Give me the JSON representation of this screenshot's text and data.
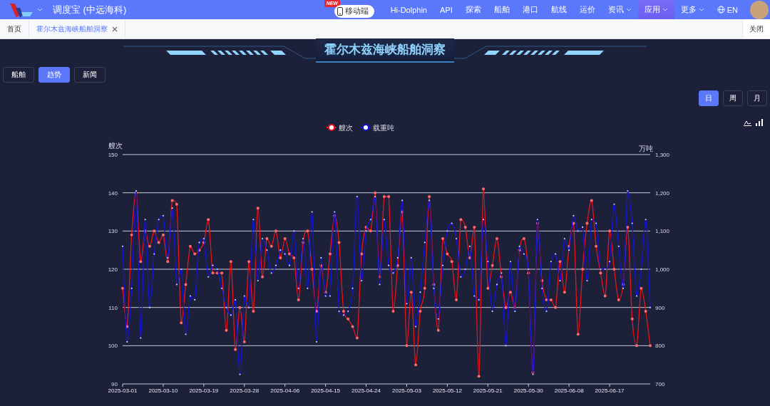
{
  "nav": {
    "title": "调度宝 (中远海科)",
    "mobile": {
      "label": "移动端",
      "badge": "NEW"
    },
    "items": [
      {
        "label": "Hi-Dolphin",
        "dropdown": false,
        "selected": false
      },
      {
        "label": "API",
        "dropdown": false,
        "selected": false
      },
      {
        "label": "探索",
        "dropdown": false,
        "selected": false
      },
      {
        "label": "船舶",
        "dropdown": false,
        "selected": false
      },
      {
        "label": "港口",
        "dropdown": false,
        "selected": false
      },
      {
        "label": "航线",
        "dropdown": false,
        "selected": false
      },
      {
        "label": "运价",
        "dropdown": false,
        "selected": false
      },
      {
        "label": "资讯",
        "dropdown": true,
        "selected": false
      },
      {
        "label": "应用",
        "dropdown": true,
        "selected": true
      },
      {
        "label": "更多",
        "dropdown": true,
        "selected": false
      }
    ],
    "language": "EN"
  },
  "tabs": {
    "items": [
      {
        "label": "首页",
        "selected": false,
        "closable": false
      },
      {
        "label": "霍尔木兹海峡船舶洞察",
        "selected": true,
        "closable": true
      }
    ],
    "close_all": "关闭"
  },
  "banner": {
    "title": "霍尔木兹海峡船舶洞察"
  },
  "views": [
    {
      "label": "船舶",
      "selected": false
    },
    {
      "label": "趋势",
      "selected": true
    },
    {
      "label": "新闻",
      "selected": false
    }
  ],
  "periods": [
    {
      "label": "日",
      "selected": true
    },
    {
      "label": "周",
      "selected": false
    },
    {
      "label": "月",
      "selected": false
    }
  ],
  "chart": {
    "chart_data": {
      "type": "line",
      "grid": true,
      "legend": "top",
      "ylabel": "艘次",
      "y2label": "万吨",
      "categories": [
        "2025-03-01",
        null,
        null,
        null,
        null,
        null,
        null,
        null,
        null,
        "2025-03-10",
        null,
        null,
        null,
        null,
        null,
        null,
        null,
        null,
        "2025-03-19",
        null,
        null,
        null,
        null,
        null,
        null,
        null,
        null,
        "2025-03-28",
        null,
        null,
        null,
        null,
        null,
        null,
        null,
        null,
        "2025-04-06",
        null,
        null,
        null,
        null,
        null,
        null,
        null,
        null,
        "2025-04-15",
        null,
        null,
        null,
        null,
        null,
        null,
        null,
        null,
        "2025-04-24",
        null,
        null,
        null,
        null,
        null,
        null,
        null,
        null,
        "2025-05-03",
        null,
        null,
        null,
        null,
        null,
        null,
        null,
        null,
        "2025-05-12",
        null,
        null,
        null,
        null,
        null,
        null,
        null,
        null,
        "2025-05-21",
        null,
        null,
        null,
        null,
        null,
        null,
        null,
        null,
        "2025-05-30",
        null,
        null,
        null,
        null,
        null,
        null,
        null,
        null,
        "2025-06-08",
        null,
        null,
        null,
        null,
        null,
        null,
        null,
        null,
        "2025-06-17",
        null,
        null,
        null,
        null,
        null,
        null,
        null,
        null,
        null
      ],
      "ylim": [
        90,
        150
      ],
      "yticks": [
        90,
        100,
        110,
        120,
        130,
        140,
        150
      ],
      "y2lim": [
        700,
        1300
      ],
      "y2ticks": [
        {
          "value": 700,
          "label": "700"
        },
        {
          "value": 800,
          "label": "800"
        },
        {
          "value": 900,
          "label": "900"
        },
        {
          "value": 1000,
          "label": "1,000"
        },
        {
          "value": 1100,
          "label": "1,100"
        },
        {
          "value": 1200,
          "label": "1,200"
        },
        {
          "value": 1300,
          "label": "1,300"
        }
      ],
      "series": [
        {
          "name": "艘次",
          "color": "#e8141c",
          "values": [
            115,
            105,
            129,
            140,
            122,
            130,
            126,
            130,
            127,
            129,
            122,
            138,
            137,
            106,
            116,
            126,
            124,
            125,
            127,
            133,
            119,
            119,
            119,
            104,
            122,
            99,
            110,
            101,
            122,
            109,
            136,
            118,
            128,
            126,
            130,
            123,
            128,
            124,
            123,
            112,
            127,
            130,
            120,
            109,
            121,
            114,
            124,
            134,
            127,
            109,
            107,
            105,
            102,
            124,
            131,
            130,
            140,
            118,
            139,
            139,
            109,
            121,
            135,
            100,
            114,
            95,
            109,
            115,
            139,
            116,
            104,
            128,
            124,
            122,
            112,
            133,
            131,
            123,
            131,
            92,
            141,
            115,
            121,
            128,
            118,
            110,
            114,
            110,
            125,
            128,
            119,
            93,
            132,
            117,
            112,
            112,
            110,
            122,
            114,
            126,
            132,
            103,
            120,
            132,
            138,
            126,
            119,
            113,
            130,
            120,
            112,
            116,
            131,
            107,
            100,
            115,
            109,
            100
          ]
        },
        {
          "name": "载重吨",
          "color": "#1414d8",
          "axis": "y2",
          "values": [
            1060,
            810,
            950,
            1205,
            820,
            1130,
            900,
            1040,
            1130,
            1140,
            1030,
            1160,
            960,
            1000,
            830,
            930,
            920,
            1070,
            1080,
            980,
            1010,
            1000,
            950,
            900,
            880,
            920,
            725,
            930,
            900,
            1130,
            970,
            1080,
            1050,
            990,
            1010,
            1050,
            1040,
            1010,
            1100,
            950,
            1080,
            950,
            1150,
            810,
            1030,
            930,
            930,
            1150,
            890,
            880,
            890,
            950,
            1190,
            970,
            1100,
            1130,
            1190,
            960,
            1130,
            1010,
            990,
            1030,
            1180,
            910,
            1030,
            850,
            940,
            1070,
            1180,
            950,
            870,
            1010,
            1100,
            1120,
            1080,
            980,
            1000,
            1060,
            930,
            920,
            1130,
            1020,
            890,
            960,
            990,
            800,
            1020,
            890,
            1060,
            1040,
            1000,
            725,
            1130,
            950,
            890,
            1020,
            1040,
            970,
            1080,
            1050,
            1140,
            1100,
            1110,
            970,
            1130,
            1120,
            1000,
            1000,
            1020,
            1170,
            1060,
            950,
            1205,
            1120,
            930,
            1000,
            1130,
            900
          ]
        }
      ]
    }
  }
}
